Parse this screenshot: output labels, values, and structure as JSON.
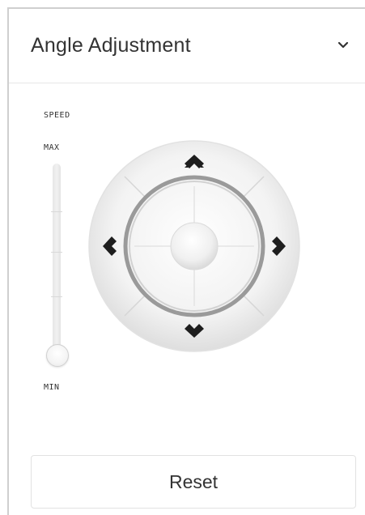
{
  "header": {
    "title": "Angle Adjustment",
    "toggle_icon": "chevron-down-icon"
  },
  "speed": {
    "label": "SPEED",
    "max_label": "MAX",
    "min_label": "MIN",
    "level": 0
  },
  "joystick": {
    "up_icon": "arrow-up-icon",
    "down_icon": "arrow-down-icon",
    "left_icon": "arrow-left-icon",
    "right_icon": "arrow-right-icon",
    "center_icon": "joystick-knob"
  },
  "reset": {
    "label": "Reset"
  }
}
